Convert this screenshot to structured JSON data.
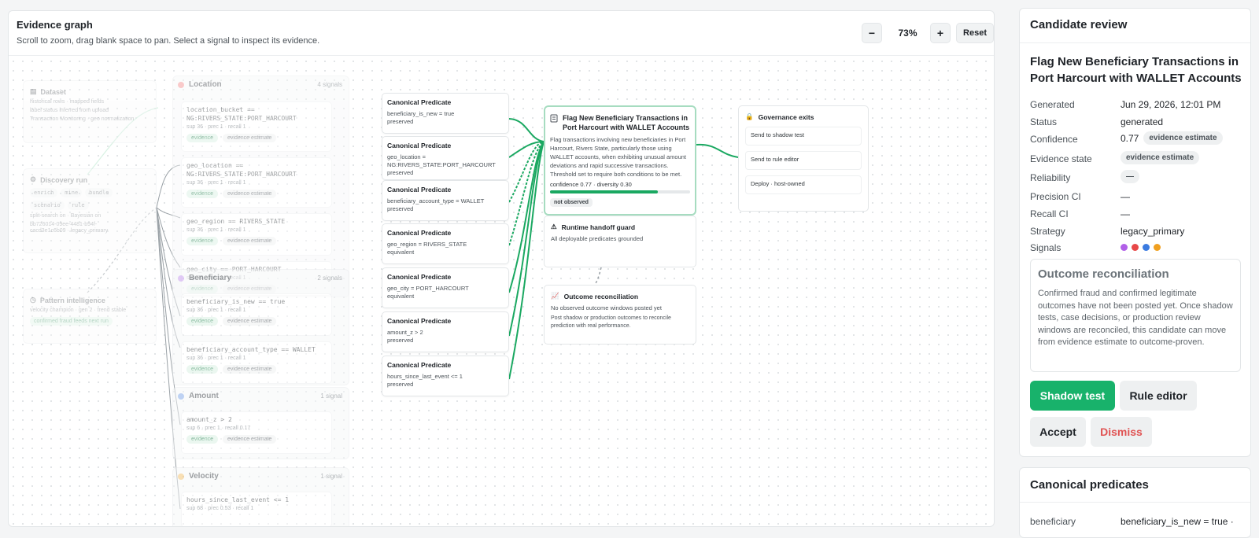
{
  "graph": {
    "title": "Evidence graph",
    "subtitle": "Scroll to zoom, drag blank space to pan. Select a signal to inspect its evidence.",
    "zoom_minus": "−",
    "zoom_level": "73%",
    "zoom_plus": "+",
    "reset": "Reset"
  },
  "sources": {
    "dataset": {
      "title": "Dataset",
      "lines": [
        "historical rows · mapped fields",
        "label status inferred from upload",
        "Transaction Monitoring · geo normalization"
      ]
    },
    "discovery": {
      "title": "Discovery run",
      "chips": [
        "enrich",
        "mine",
        "bundle",
        "scenario",
        "rule"
      ],
      "lines": [
        "split-search on · Bayesian on",
        "bb726014-09ee-4481-b94f-",
        "cacd3e1c6b09 · legacy_primary"
      ]
    },
    "pattern": {
      "title": "Pattern intelligence",
      "lines": [
        "velocity champion · gen 2 · trend stable"
      ],
      "chip": "confirmed fraud feeds next run"
    }
  },
  "groups": {
    "location": {
      "name": "Location",
      "count": "4 signals",
      "color": "#f28b8b",
      "signals": [
        {
          "expr": "location_bucket ==\nNG:RIVERS_STATE:PORT_HARCOURT",
          "meta": "sup 36 · prec 1 · recall 1",
          "b1": "evidence",
          "b2": "evidence estimate"
        },
        {
          "expr": "geo_location ==\nNG:RIVERS_STATE:PORT_HARCOURT",
          "meta": "sup 36 · prec 1 · recall 1",
          "b1": "evidence",
          "b2": "evidence estimate"
        },
        {
          "expr": "geo_region == RIVERS_STATE",
          "meta": "sup 36 · prec 1 · recall 1",
          "b1": "evidence",
          "b2": "evidence estimate"
        },
        {
          "expr": "geo_city == PORT_HARCOURT",
          "meta": "sup 36 · prec 1 · recall 1",
          "b1": "evidence",
          "b2": "evidence estimate"
        }
      ]
    },
    "beneficiary": {
      "name": "Beneficiary",
      "count": "2 signals",
      "color": "#c89af0",
      "signals": [
        {
          "expr": "beneficiary_is_new == true",
          "meta": "sup 36 · prec 1 · recall 1",
          "b1": "evidence",
          "b2": "evidence estimate"
        },
        {
          "expr": "beneficiary_account_type == WALLET",
          "meta": "sup 36 · prec 1 · recall 1",
          "b1": "evidence",
          "b2": "evidence estimate"
        }
      ]
    },
    "amount": {
      "name": "Amount",
      "count": "1 signal",
      "color": "#7fa7e8",
      "signals": [
        {
          "expr": "amount_z > 2",
          "meta": "sup 6 · prec 1 · recall 0.17",
          "b1": "evidence",
          "b2": "evidence estimate"
        }
      ]
    },
    "velocity": {
      "name": "Velocity",
      "count": "1 signal",
      "color": "#f2c16b",
      "signals": [
        {
          "expr": "hours_since_last_event <= 1",
          "meta": "sup 68 · prec 0.53 · recall 1"
        }
      ]
    }
  },
  "predicates": [
    {
      "title": "Canonical Predicate",
      "body": "beneficiary_is_new = true\npreserved"
    },
    {
      "title": "Canonical Predicate",
      "body": "geo_location =\nNG:RIVERS_STATE:PORT_HARCOURT\npreserved"
    },
    {
      "title": "Canonical Predicate",
      "body": "beneficiary_account_type = WALLET\npreserved"
    },
    {
      "title": "Canonical Predicate",
      "body": "geo_region = RIVERS_STATE\nequivalent"
    },
    {
      "title": "Canonical Predicate",
      "body": "geo_city = PORT_HARCOURT\nequivalent"
    },
    {
      "title": "Canonical Predicate",
      "body": "amount_z > 2\npreserved"
    },
    {
      "title": "Canonical Predicate",
      "body": "hours_since_last_event <= 1\npreserved"
    }
  ],
  "candidate_node": {
    "title": "Flag New Beneficiary Transactions in Port Harcourt with WALLET Accounts",
    "description": "Flag transactions involving new beneficiaries in Port Harcourt, Rivers State, particularly those using WALLET accounts, when exhibiting unusual amount deviations and rapid successive transactions. Threshold set to require both conditions to be met.",
    "metrics": "confidence 0.77 · diversity 0.30",
    "confidence_fraction": 0.77,
    "status_chip": "not observed"
  },
  "guard": {
    "title": "Runtime handoff guard",
    "line": "All deployable predicates grounded"
  },
  "outcome_node": {
    "title": "Outcome reconciliation",
    "line1": "No observed outcome windows posted yet",
    "line2": "Post shadow or production outcomes to reconcile\nprediction with real performance."
  },
  "governance": {
    "title": "Governance exits",
    "items": [
      "Send to shadow test",
      "Send to rule editor",
      "Deploy · host-owned"
    ]
  },
  "review": {
    "header": "Candidate review",
    "title": "Flag New Beneficiary Transactions in Port Harcourt with WALLET Accounts",
    "fields": {
      "generated_label": "Generated",
      "generated": "Jun 29, 2026, 12:01 PM",
      "status_label": "Status",
      "status": "generated",
      "confidence_label": "Confidence",
      "confidence": "0.77",
      "confidence_pill": "evidence estimate",
      "evidence_label": "Evidence state",
      "evidence_pill": "evidence estimate",
      "reliability_label": "Reliability",
      "reliability_pill": "—",
      "precision_label": "Precision CI",
      "precision": "—",
      "recall_label": "Recall CI",
      "recall": "—",
      "strategy_label": "Strategy",
      "strategy": "legacy_primary",
      "signals_label": "Signals",
      "signal_colors": [
        "#b160e8",
        "#e84848",
        "#3b7be0",
        "#f0a020"
      ]
    },
    "outcome": {
      "title": "Outcome reconciliation",
      "body": "Confirmed fraud and confirmed legitimate outcomes have not been posted yet. Once shadow tests, case decisions, or production review windows are reconciled, this candidate can move from evidence estimate to outcome-proven."
    },
    "actions": {
      "shadow": "Shadow test",
      "rule": "Rule editor",
      "accept": "Accept",
      "dismiss": "Dismiss"
    }
  },
  "canonical": {
    "header": "Canonical predicates",
    "row_key": "beneficiary",
    "row_val": "beneficiary_is_new = true ·"
  },
  "colors": {
    "accent_green": "#18b26b",
    "dismiss_red": "#e05252"
  }
}
